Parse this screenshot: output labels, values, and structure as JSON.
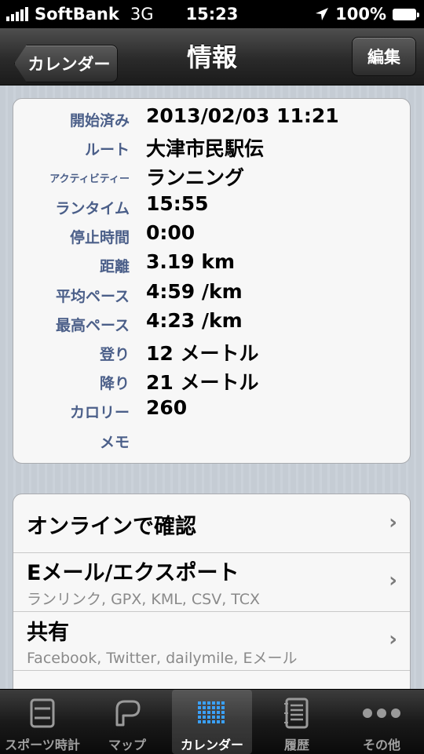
{
  "status_bar": {
    "carrier": "SoftBank",
    "network": "3G",
    "time": "15:23",
    "battery": "100%"
  },
  "nav": {
    "back_label": "カレンダー",
    "title": "情報",
    "edit_label": "編集"
  },
  "details": [
    {
      "label": "開始済み",
      "value": "2013/02/03 11:21"
    },
    {
      "label": "ルート",
      "value": "大津市民駅伝"
    },
    {
      "label": "アクティビティー",
      "value": "ランニング"
    },
    {
      "label": "ランタイム",
      "value": "15:55"
    },
    {
      "label": "停止時間",
      "value": "0:00"
    },
    {
      "label": "距離",
      "value": "3.19 km"
    },
    {
      "label": "平均ペース",
      "value": "4:59 /km"
    },
    {
      "label": "最高ペース",
      "value": "4:23 /km"
    },
    {
      "label": "登り",
      "value": "12 メートル"
    },
    {
      "label": "降り",
      "value": "21 メートル"
    },
    {
      "label": "カロリー",
      "value": "260"
    },
    {
      "label": "メモ",
      "value": ""
    }
  ],
  "actions": [
    {
      "title": "オンラインで確認",
      "subtitle": ""
    },
    {
      "title": "Eメール/エクスポート",
      "subtitle": "ランリンク, GPX, KML, CSV, TCX"
    },
    {
      "title": "共有",
      "subtitle": "Facebook, Twitter, dailymile, Eメール"
    }
  ],
  "tabs": [
    {
      "label": "スポーツ時計",
      "icon": "stopwatch-icon"
    },
    {
      "label": "マップ",
      "icon": "map-icon"
    },
    {
      "label": "カレンダー",
      "icon": "calendar-grid-icon",
      "active": true
    },
    {
      "label": "履歴",
      "icon": "notebook-icon"
    },
    {
      "label": "その他",
      "icon": "more-dots-icon"
    }
  ],
  "colors": {
    "label_blue": "#4b5f89",
    "accent_calendar": "#3aa1ff"
  }
}
